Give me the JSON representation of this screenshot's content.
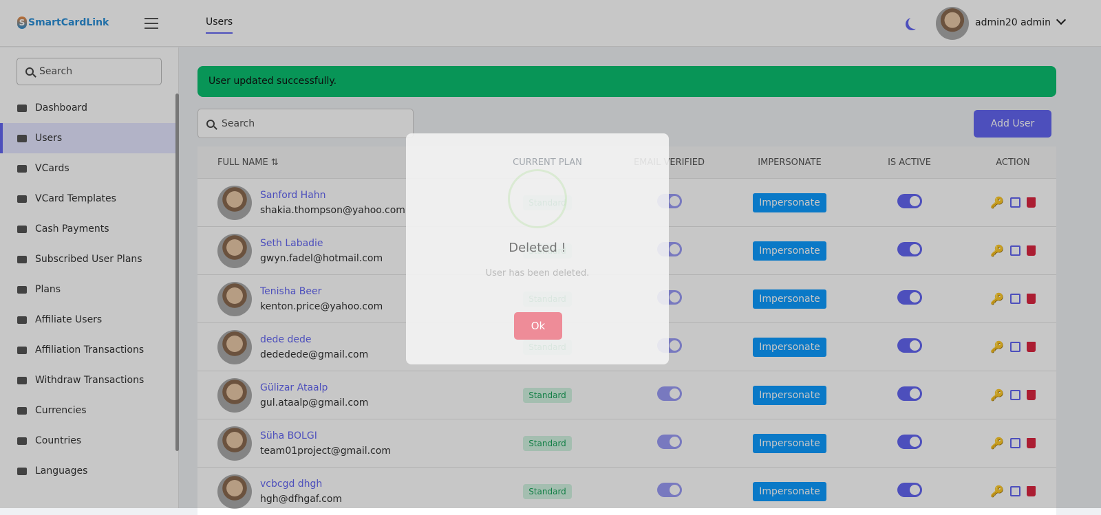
{
  "header": {
    "logo": "SmartCardLink",
    "logo_mark": "S",
    "tab": "Users",
    "user_name": "admin20 admin"
  },
  "sidebar": {
    "search_placeholder": "Search",
    "items": [
      {
        "label": "Dashboard"
      },
      {
        "label": "Users"
      },
      {
        "label": "VCards"
      },
      {
        "label": "VCard Templates"
      },
      {
        "label": "Cash Payments"
      },
      {
        "label": "Subscribed User Plans"
      },
      {
        "label": "Plans"
      },
      {
        "label": "Affiliate Users"
      },
      {
        "label": "Affiliation Transactions"
      },
      {
        "label": "Withdraw Transactions"
      },
      {
        "label": "Currencies"
      },
      {
        "label": "Countries"
      },
      {
        "label": "Languages"
      }
    ]
  },
  "main": {
    "alert": "User updated successfully.",
    "search_placeholder": "Search",
    "add_user": "Add User",
    "columns": {
      "name": "FULL NAME ⇅",
      "plan": "CURRENT PLAN",
      "email_verified": "EMAIL VERIFIED",
      "impersonate": "IMPERSONATE",
      "is_active": "IS ACTIVE",
      "action": "ACTION"
    },
    "rows": [
      {
        "name": "Sanford Hahn",
        "email": "shakia.thompson@yahoo.com",
        "plan": "Standard",
        "impersonate": "Impersonate"
      },
      {
        "name": "Seth Labadie",
        "email": "gwyn.fadel@hotmail.com",
        "plan": "Standard",
        "impersonate": "Impersonate"
      },
      {
        "name": "Tenisha Beer",
        "email": "kenton.price@yahoo.com",
        "plan": "Standard",
        "impersonate": "Impersonate"
      },
      {
        "name": "dede dede",
        "email": "dededede@gmail.com",
        "plan": "Standard",
        "impersonate": "Impersonate"
      },
      {
        "name": "Gülizar Ataalp",
        "email": "gul.ataalp@gmail.com",
        "plan": "Standard",
        "impersonate": "Impersonate"
      },
      {
        "name": "Süha BOLGI",
        "email": "team01project@gmail.com",
        "plan": "Standard",
        "impersonate": "Impersonate"
      },
      {
        "name": "vcbcgd dhgh",
        "email": "hgh@dfhgaf.com",
        "plan": "Standard",
        "impersonate": "Impersonate"
      }
    ]
  },
  "modal": {
    "title": "Deleted !",
    "text": "User has been deleted.",
    "ok": "Ok"
  },
  "colors": {
    "accent": "#6366f1",
    "success": "#0bbf70",
    "impersonate": "#0d9bff",
    "danger": "#dc2640",
    "key": "#f2a600"
  }
}
